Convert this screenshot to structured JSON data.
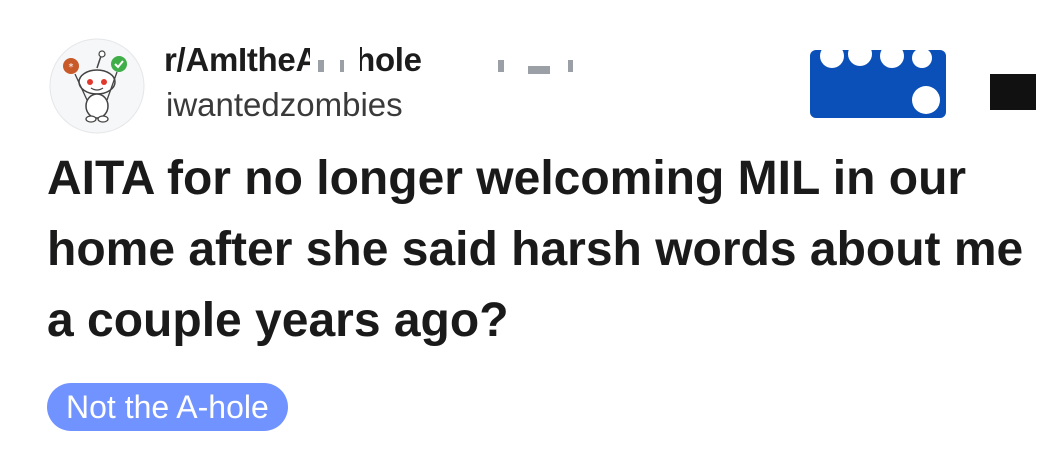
{
  "post_header": {
    "subreddit": "r/AmItheAsshole",
    "username": "iwantedzombies"
  },
  "post": {
    "title": "AITA for no longer welcoming MIL in our home after she said harsh words about me a couple years ago?",
    "flair": "Not the A-hole"
  },
  "colors": {
    "flair_bg": "#7193ff",
    "join_button": "#0a50b8",
    "text": "#1a1a1b"
  },
  "icons": {
    "avatar": "snoo-avatar-icon",
    "menu": "more-options-icon"
  }
}
